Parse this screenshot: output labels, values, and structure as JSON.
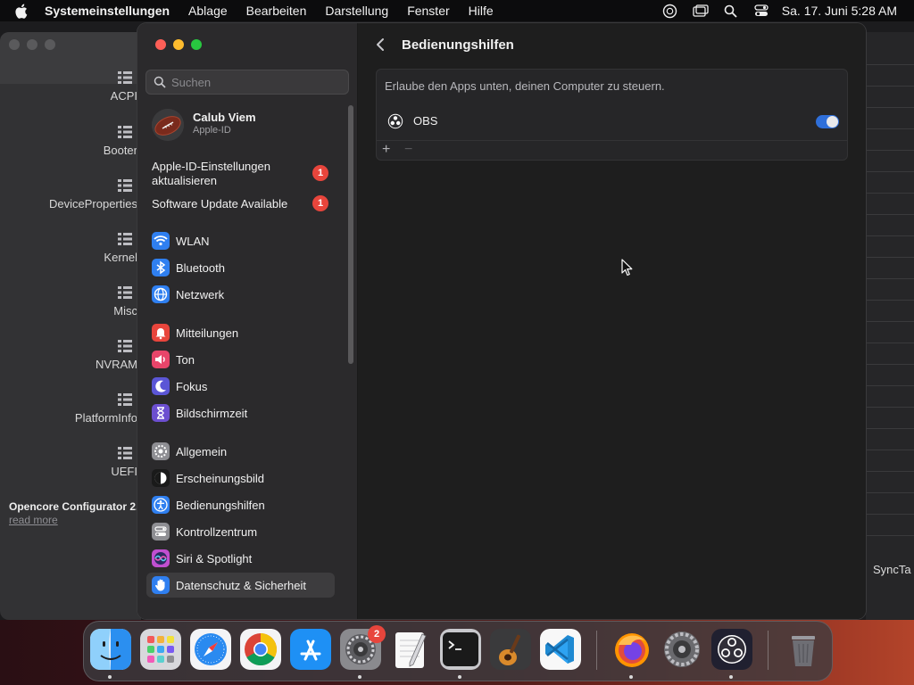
{
  "menubar": {
    "app": "Systemeinstellungen",
    "items": [
      "Ablage",
      "Bearbeiten",
      "Darstellung",
      "Fenster",
      "Hilfe"
    ],
    "clock": "Sa. 17. Juni  5:28 AM",
    "status_icons": [
      "accessibility-status-icon",
      "screen-mirroring-icon",
      "spotlight-search-icon",
      "control-center-icon"
    ]
  },
  "background_window": {
    "items": [
      "ACPI",
      "Booter",
      "DeviceProperties",
      "Kernel",
      "Misc",
      "NVRAM",
      "PlatformInfo",
      "UEFI"
    ],
    "title": "Opencore Configurator 2.",
    "link": "read more",
    "right_label": "SyncTa"
  },
  "sidebar": {
    "search_placeholder": "Suchen",
    "profile": {
      "name": "Calub Viem",
      "subtitle": "Apple-ID"
    },
    "notices": [
      {
        "label": "Apple-ID-Einstellungen aktualisieren",
        "badge": "1"
      },
      {
        "label": "Software Update Available",
        "badge": "1"
      }
    ],
    "items": [
      {
        "label": "WLAN",
        "icon": "wifi-icon",
        "color": "#2f7ff0"
      },
      {
        "label": "Bluetooth",
        "icon": "bluetooth-icon",
        "color": "#2f7ff0"
      },
      {
        "label": "Netzwerk",
        "icon": "globe-icon",
        "color": "#2f7ff0"
      },
      {
        "label": "Mitteilungen",
        "icon": "bell-icon",
        "color": "#e8453c"
      },
      {
        "label": "Ton",
        "icon": "speaker-icon",
        "color": "#e8456a"
      },
      {
        "label": "Fokus",
        "icon": "moon-icon",
        "color": "#5b56d6"
      },
      {
        "label": "Bildschirmzeit",
        "icon": "hourglass-icon",
        "color": "#6c4fd0"
      },
      {
        "label": "Allgemein",
        "icon": "gear-icon",
        "color": "#8e8e93"
      },
      {
        "label": "Erscheinungsbild",
        "icon": "appearance-icon",
        "color": "#1a1a1a"
      },
      {
        "label": "Bedienungshilfen",
        "icon": "accessibility-icon",
        "color": "#2f7ff0"
      },
      {
        "label": "Kontrollzentrum",
        "icon": "control-center-icon",
        "color": "#8e8e93"
      },
      {
        "label": "Siri & Spotlight",
        "icon": "siri-icon",
        "color": "#c04fd0"
      },
      {
        "label": "Datenschutz & Sicherheit",
        "icon": "hand-icon",
        "color": "#2f7ff0"
      }
    ],
    "active_index": 12
  },
  "main": {
    "title": "Bedienungshilfen",
    "description": "Erlaube den Apps unten, deinen Computer zu steuern.",
    "apps": [
      {
        "name": "OBS",
        "enabled": true
      }
    ],
    "add_label": "+",
    "remove_label": "−"
  },
  "dock": {
    "apps": [
      "Finder",
      "Launchpad",
      "Safari",
      "Chrome",
      "App Store",
      "Systemeinstellungen",
      "TextEdit",
      "Terminal",
      "GarageBand",
      "Visual Studio Code",
      "Firefox",
      "Compressor",
      "OBS",
      "Papierkorb"
    ],
    "settings_badge": "2"
  }
}
